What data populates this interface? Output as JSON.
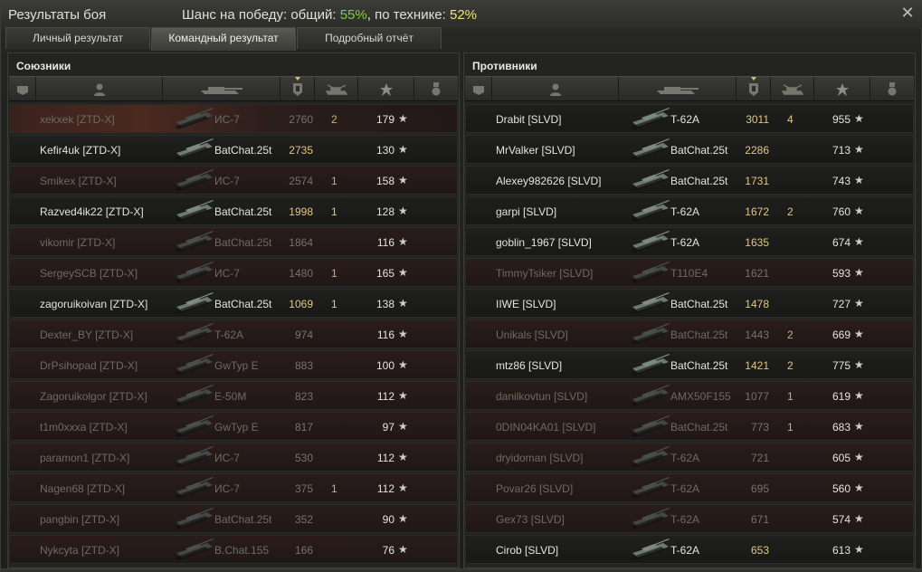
{
  "window": {
    "title": "Результаты боя",
    "chance_prefix": "Шанс на победу: общий: ",
    "chance_total": "55%",
    "chance_mid": ", по технике: ",
    "chance_tech": "52%",
    "close_icon": "close-icon"
  },
  "tabs": [
    {
      "label": "Личный результат",
      "active": false
    },
    {
      "label": "Командный результат",
      "active": true
    },
    {
      "label": "Подробный отчёт",
      "active": false
    }
  ],
  "columns_icons": [
    "vehicle-type-icon",
    "player-icon",
    "tank-icon",
    "damage-icon",
    "kills-icon",
    "xp-star-icon",
    "medal-icon"
  ],
  "allies": {
    "title": "Союзники",
    "rows": [
      {
        "name": "xekxek [ZTD-X]",
        "tank": "ИС-7",
        "damage": "2760",
        "kills": "2",
        "xp": "179",
        "alive": false
      },
      {
        "name": "Kefir4uk [ZTD-X]",
        "tank": "BatChat.25t",
        "damage": "2735",
        "kills": "",
        "xp": "130",
        "alive": true
      },
      {
        "name": "Smikex [ZTD-X]",
        "tank": "ИС-7",
        "damage": "2574",
        "kills": "1",
        "xp": "158",
        "alive": false
      },
      {
        "name": "Razved4ik22 [ZTD-X]",
        "tank": "BatChat.25t",
        "damage": "1998",
        "kills": "1",
        "xp": "128",
        "alive": true
      },
      {
        "name": "vikomir [ZTD-X]",
        "tank": "BatChat.25t",
        "damage": "1864",
        "kills": "",
        "xp": "116",
        "alive": false
      },
      {
        "name": "SergeySCB [ZTD-X]",
        "tank": "ИС-7",
        "damage": "1480",
        "kills": "1",
        "xp": "165",
        "alive": false
      },
      {
        "name": "zagoruikoivan [ZTD-X]",
        "tank": "BatChat.25t",
        "damage": "1069",
        "kills": "1",
        "xp": "138",
        "alive": true
      },
      {
        "name": "Dexter_BY [ZTD-X]",
        "tank": "T-62A",
        "damage": "974",
        "kills": "",
        "xp": "116",
        "alive": false
      },
      {
        "name": "DrPsihopad [ZTD-X]",
        "tank": "GwTyp E",
        "damage": "883",
        "kills": "",
        "xp": "100",
        "alive": false
      },
      {
        "name": "Zagoruikolgor [ZTD-X]",
        "tank": "E-50M",
        "damage": "823",
        "kills": "",
        "xp": "112",
        "alive": false
      },
      {
        "name": "t1m0xxxa [ZTD-X]",
        "tank": "GwTyp E",
        "damage": "817",
        "kills": "",
        "xp": "97",
        "alive": false
      },
      {
        "name": "paramon1 [ZTD-X]",
        "tank": "ИС-7",
        "damage": "530",
        "kills": "",
        "xp": "112",
        "alive": false
      },
      {
        "name": "Nagen68 [ZTD-X]",
        "tank": "ИС-7",
        "damage": "375",
        "kills": "1",
        "xp": "112",
        "alive": false
      },
      {
        "name": "pangbin [ZTD-X]",
        "tank": "BatChat.25t",
        "damage": "352",
        "kills": "",
        "xp": "90",
        "alive": false
      },
      {
        "name": "Nykcyta [ZTD-X]",
        "tank": "B.Chat.155",
        "damage": "166",
        "kills": "",
        "xp": "76",
        "alive": false
      }
    ]
  },
  "enemies": {
    "title": "Противники",
    "rows": [
      {
        "name": "Drabit [SLVD]",
        "tank": "T-62A",
        "damage": "3011",
        "kills": "4",
        "xp": "955",
        "alive": true
      },
      {
        "name": "MrValker [SLVD]",
        "tank": "BatChat.25t",
        "damage": "2286",
        "kills": "",
        "xp": "713",
        "alive": true
      },
      {
        "name": "Alexey982626 [SLVD]",
        "tank": "BatChat.25t",
        "damage": "1731",
        "kills": "",
        "xp": "743",
        "alive": true
      },
      {
        "name": "garpi [SLVD]",
        "tank": "T-62A",
        "damage": "1672",
        "kills": "2",
        "xp": "760",
        "alive": true
      },
      {
        "name": "goblin_1967 [SLVD]",
        "tank": "T-62A",
        "damage": "1635",
        "kills": "",
        "xp": "674",
        "alive": true
      },
      {
        "name": "TimmyTsiker [SLVD]",
        "tank": "T110E4",
        "damage": "1621",
        "kills": "",
        "xp": "593",
        "alive": false
      },
      {
        "name": "IIWE [SLVD]",
        "tank": "BatChat.25t",
        "damage": "1478",
        "kills": "",
        "xp": "727",
        "alive": true
      },
      {
        "name": "Unikals [SLVD]",
        "tank": "BatChat.25t",
        "damage": "1443",
        "kills": "2",
        "xp": "669",
        "alive": false
      },
      {
        "name": "mtz86 [SLVD]",
        "tank": "BatChat.25t",
        "damage": "1421",
        "kills": "2",
        "xp": "775",
        "alive": true
      },
      {
        "name": "danilkovtun [SLVD]",
        "tank": "AMX50F155",
        "damage": "1077",
        "kills": "1",
        "xp": "619",
        "alive": false
      },
      {
        "name": "0DIN04KA01 [SLVD]",
        "tank": "BatChat.25t",
        "damage": "773",
        "kills": "1",
        "xp": "683",
        "alive": false
      },
      {
        "name": "dryidoman [SLVD]",
        "tank": "T-62A",
        "damage": "721",
        "kills": "",
        "xp": "605",
        "alive": false
      },
      {
        "name": "Povar26 [SLVD]",
        "tank": "T-62A",
        "damage": "695",
        "kills": "",
        "xp": "560",
        "alive": false
      },
      {
        "name": "Gex73 [SLVD]",
        "tank": "T-62A",
        "damage": "671",
        "kills": "",
        "xp": "574",
        "alive": false
      },
      {
        "name": "Cirob [SLVD]",
        "tank": "T-62A",
        "damage": "653",
        "kills": "",
        "xp": "613",
        "alive": true
      }
    ]
  }
}
